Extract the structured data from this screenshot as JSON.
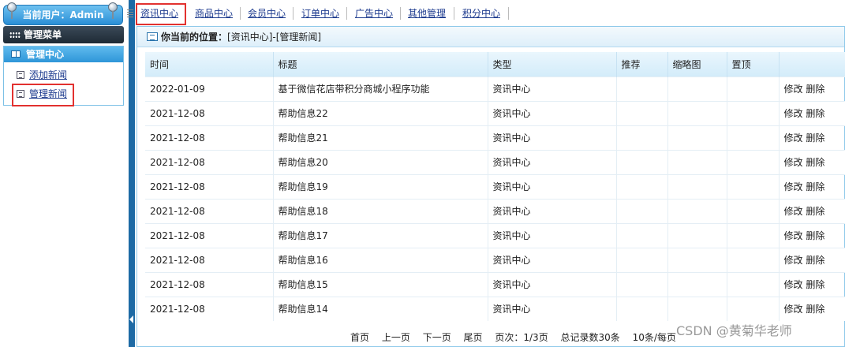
{
  "user_bar": {
    "label": "当前用户：Admin"
  },
  "menu": {
    "header": "管理菜单",
    "section_title": "管理中心",
    "items": [
      {
        "label": "添加新闻"
      },
      {
        "label": "管理新闻"
      }
    ]
  },
  "topnav": {
    "tabs": [
      {
        "label": "资讯中心"
      },
      {
        "label": "商品中心"
      },
      {
        "label": "会员中心"
      },
      {
        "label": "订单中心"
      },
      {
        "label": "广告中心"
      },
      {
        "label": "其他管理"
      },
      {
        "label": "积分中心"
      }
    ]
  },
  "breadcrumb": {
    "label": "你当前的位置：",
    "path": "[资讯中心]-[管理新闻]"
  },
  "table": {
    "headers": [
      "时间",
      "标题",
      "类型",
      "推荐",
      "缩略图",
      "置顶",
      ""
    ],
    "rows": [
      {
        "time": "2022-01-09",
        "title": "基于微信花店带积分商城小程序功能",
        "type": "资讯中心"
      },
      {
        "time": "2021-12-08",
        "title": "帮助信息22",
        "type": "资讯中心"
      },
      {
        "time": "2021-12-08",
        "title": "帮助信息21",
        "type": "资讯中心"
      },
      {
        "time": "2021-12-08",
        "title": "帮助信息20",
        "type": "资讯中心"
      },
      {
        "time": "2021-12-08",
        "title": "帮助信息19",
        "type": "资讯中心"
      },
      {
        "time": "2021-12-08",
        "title": "帮助信息18",
        "type": "资讯中心"
      },
      {
        "time": "2021-12-08",
        "title": "帮助信息17",
        "type": "资讯中心"
      },
      {
        "time": "2021-12-08",
        "title": "帮助信息16",
        "type": "资讯中心"
      },
      {
        "time": "2021-12-08",
        "title": "帮助信息15",
        "type": "资讯中心"
      },
      {
        "time": "2021-12-08",
        "title": "帮助信息14",
        "type": "资讯中心"
      }
    ],
    "edit_label": "修改",
    "delete_label": "删除"
  },
  "pager": {
    "first": "首页",
    "prev": "上一页",
    "next": "下一页",
    "last": "尾页",
    "page_info": "页次：1/3页",
    "total": "总记录数30条",
    "per_page": "10条/每页"
  },
  "watermark": "CSDN @黄菊华老师",
  "colors": {
    "accent": "#2a8fd6",
    "highlight": "#e2312f",
    "link": "#1c3a8e"
  }
}
